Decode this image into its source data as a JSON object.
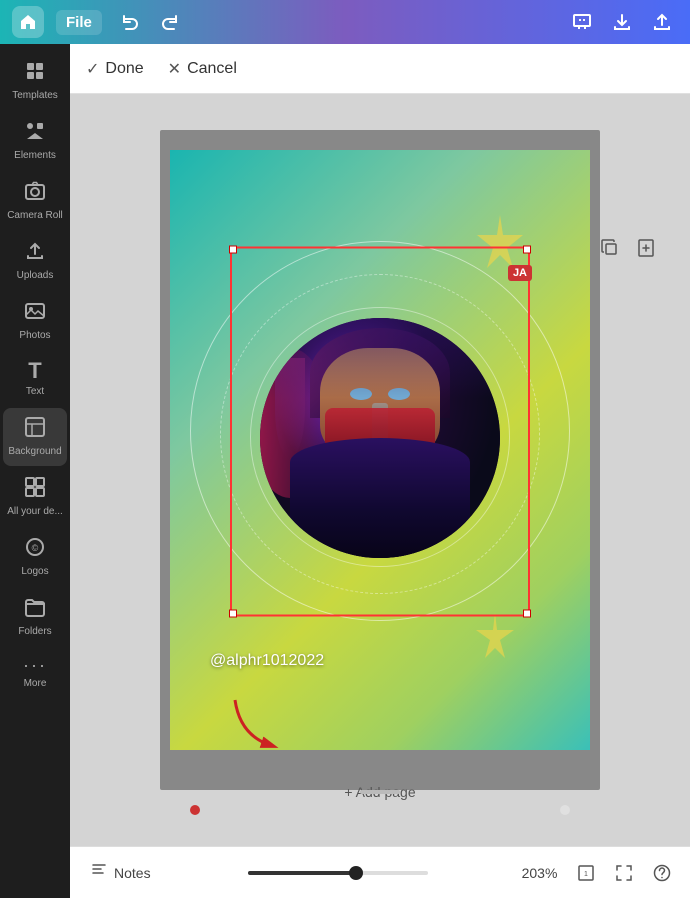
{
  "topbar": {
    "file_label": "File",
    "undo_icon": "↩",
    "redo_icon": "↪",
    "save_icon": "⬇",
    "share_icon": "↗",
    "present_icon": "⬆"
  },
  "actionbar": {
    "done_label": "Done",
    "cancel_label": "Cancel"
  },
  "sidebar": {
    "items": [
      {
        "id": "templates",
        "label": "Templates",
        "icon": "⊞"
      },
      {
        "id": "elements",
        "label": "Elements",
        "icon": "✦"
      },
      {
        "id": "camera-roll",
        "label": "Camera Roll",
        "icon": "📷"
      },
      {
        "id": "uploads",
        "label": "Uploads",
        "icon": "⬆"
      },
      {
        "id": "photos",
        "label": "Photos",
        "icon": "🖼"
      },
      {
        "id": "text",
        "label": "Text",
        "icon": "T"
      },
      {
        "id": "background",
        "label": "Background",
        "icon": "▦"
      },
      {
        "id": "all-your-designs",
        "label": "All your de...",
        "icon": "⊟"
      },
      {
        "id": "logos",
        "label": "Logos",
        "icon": "©"
      },
      {
        "id": "folders",
        "label": "Folders",
        "icon": "📁"
      },
      {
        "id": "more",
        "label": "More",
        "icon": "···"
      }
    ]
  },
  "canvas": {
    "username": "@alphr1012022",
    "ja_badge": "JA",
    "add_page": "+ Add page"
  },
  "bottombar": {
    "notes_label": "Notes",
    "zoom_level": "203%",
    "notes_icon": "≡"
  }
}
